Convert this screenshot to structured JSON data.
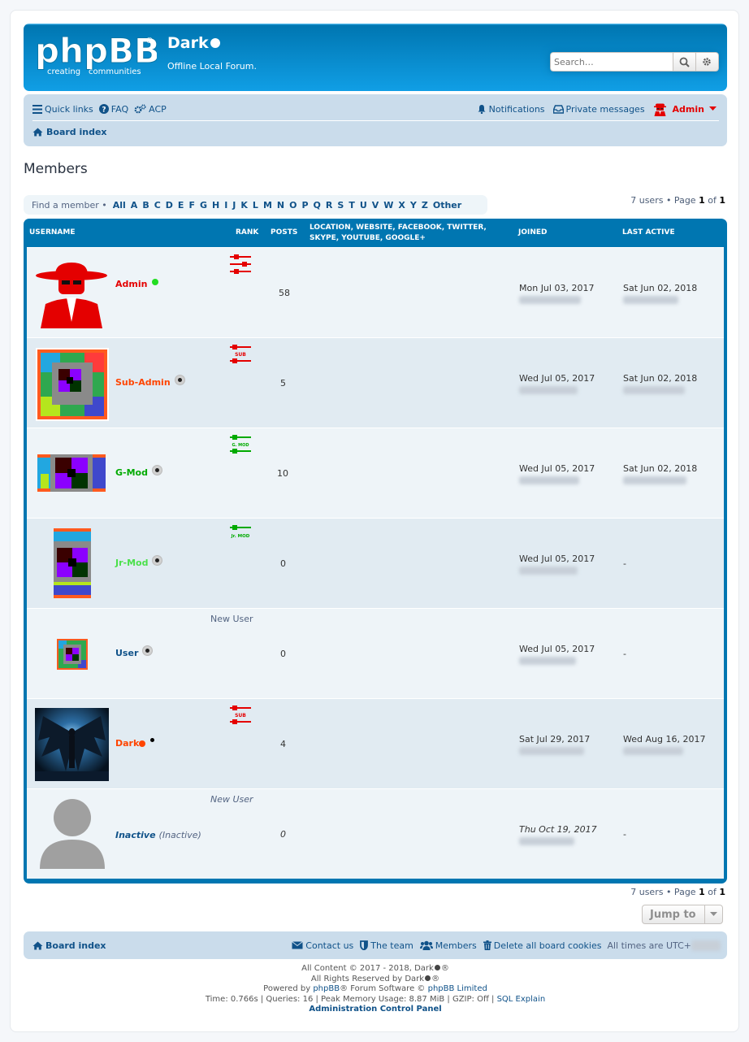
{
  "site": {
    "logo_text": "phpBB",
    "logo_tagline_1": "creating",
    "logo_tagline_2": "communities",
    "logo_reg": "®",
    "title": "Dark",
    "description": "Offline Local Forum."
  },
  "search": {
    "placeholder": "Search…"
  },
  "nav": {
    "quick_links": "Quick links",
    "faq": "FAQ",
    "acp": "ACP",
    "notifications": "Notifications",
    "private_messages": "Private messages",
    "user": "Admin",
    "board_index": "Board index"
  },
  "page": {
    "title": "Members"
  },
  "letters": {
    "label": "Find a member •",
    "items": [
      "All",
      "A",
      "B",
      "C",
      "D",
      "E",
      "F",
      "G",
      "H",
      "I",
      "J",
      "K",
      "L",
      "M",
      "N",
      "O",
      "P",
      "Q",
      "R",
      "S",
      "T",
      "U",
      "V",
      "W",
      "X",
      "Y",
      "Z",
      "Other"
    ]
  },
  "pagination": {
    "users_text": "7 users • Page",
    "page": "1",
    "of": "of",
    "total": "1"
  },
  "table": {
    "headers": {
      "username": "USERNAME",
      "rank": "RANK",
      "posts": "POSTS",
      "location_1": "LOCATION, WEBSITE, FACEBOOK, TWITTER,",
      "location_2": "SKYPE, YOUTUBE, GOOGLE+",
      "joined": "JOINED",
      "last_active": "LAST ACTIVE"
    },
    "rows": [
      {
        "username": "Admin",
        "posts": "58",
        "joined": "Mon Jul 03, 2017",
        "last_active": "Sat Jun 02, 2018"
      },
      {
        "username": "Sub-Admin",
        "rank_label": "SUB",
        "posts": "5",
        "joined": "Wed Jul 05, 2017",
        "last_active": "Sat Jun 02, 2018"
      },
      {
        "username": "G-Mod",
        "rank_label": "G. MOD",
        "posts": "10",
        "joined": "Wed Jul 05, 2017",
        "last_active": "Sat Jun 02, 2018"
      },
      {
        "username": "Jr-Mod",
        "rank_label": "Jr. MOD",
        "posts": "0",
        "joined": "Wed Jul 05, 2017",
        "last_active": "-"
      },
      {
        "username": "User",
        "rank_text": "New User",
        "posts": "0",
        "joined": "Wed Jul 05, 2017",
        "last_active": "-"
      },
      {
        "username": "Dark",
        "rank_label": "SUB",
        "posts": "4",
        "joined": "Sat Jul 29, 2017",
        "last_active": "Wed Aug 16, 2017"
      },
      {
        "username": "Inactive",
        "suffix": "(Inactive)",
        "rank_text": "New User",
        "posts": "0",
        "joined": "Thu Oct 19, 2017",
        "last_active": "-"
      }
    ]
  },
  "jump": {
    "label": "Jump to"
  },
  "footer": {
    "board_index": "Board index",
    "contact": "Contact us",
    "team": "The team",
    "members": "Members",
    "delete_cookies": "Delete all board cookies",
    "times": "All times are UTC+",
    "copy_1": "All Content © 2017 - 2018, Dark",
    "copy_1_mark": "®",
    "copy_2": "All Rights Reserved by Dark",
    "powered_1": "Powered by",
    "powered_link": "phpBB",
    "powered_2": "® Forum Software ©",
    "powered_3": "phpBB Limited",
    "stats": "Time: 0.766s | Queries: 16 | Peak Memory Usage: 8.87 MiB | GZIP: Off |",
    "sql_explain": "SQL Explain",
    "acp": "Administration Control Panel"
  },
  "colors": {
    "admin": "#e40000",
    "subadmin": "#ff4500",
    "gmod": "#00aa00",
    "jrmod": "#4be04b",
    "user": "#105289",
    "dark": "#ff4500",
    "header_blue": "#12a3eb",
    "link": "#105289"
  },
  "icons": [
    "search-icon",
    "gear-icon",
    "bars-icon",
    "question-icon",
    "cogs-icon",
    "bell-icon",
    "inbox-icon",
    "home-icon",
    "envelope-icon",
    "shield-icon",
    "users-icon",
    "trash-icon",
    "caret-down-icon"
  ]
}
